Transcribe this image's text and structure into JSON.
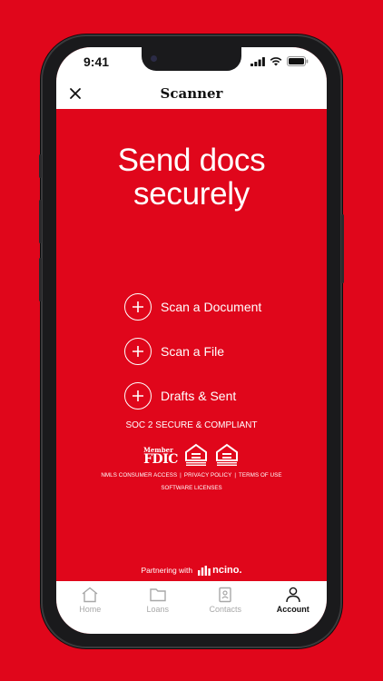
{
  "status": {
    "time": "9:41"
  },
  "header": {
    "title": "Scanner"
  },
  "headline": [
    "Send docs",
    "securely"
  ],
  "actions": [
    {
      "label": "Scan a Document"
    },
    {
      "label": "Scan a File"
    },
    {
      "label": "Drafts & Sent"
    }
  ],
  "compliance": "SOC 2 SECURE & COMPLIANT",
  "fdic": {
    "member": "Member",
    "word": "FDIC"
  },
  "equal_housing": {
    "lender": "EQUAL HOUSING LENDER",
    "opportunity": "EQUAL HOUSING OPPORTUNITY"
  },
  "links": {
    "nmls": "NMLS CONSUMER ACCESS",
    "privacy": "PRIVACY POLICY",
    "terms": "TERMS OF USE",
    "sep": "|",
    "software": "SOFTWARE LICENSES"
  },
  "partner": {
    "text": "Partnering with",
    "brand": "ncino."
  },
  "tabs": [
    {
      "label": "Home",
      "active": false
    },
    {
      "label": "Loans",
      "active": false
    },
    {
      "label": "Contacts",
      "active": false
    },
    {
      "label": "Account",
      "active": true
    }
  ],
  "colors": {
    "brand_red": "#e0061b",
    "white": "#ffffff",
    "tab_inactive": "#a8a8a8"
  }
}
